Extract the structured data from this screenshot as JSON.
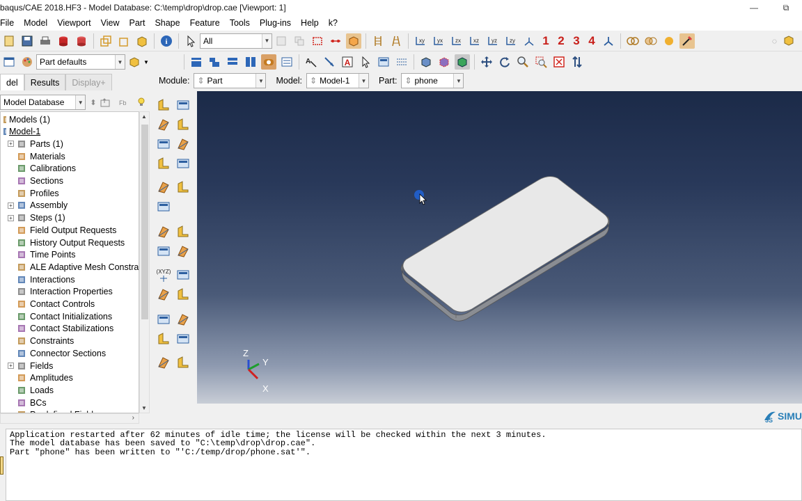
{
  "window": {
    "title": "baqus/CAE 2018.HF3 - Model Database: C:\\temp\\drop\\drop.cae [Viewport: 1]",
    "minimize": "—",
    "restore": "⧉"
  },
  "menu": [
    {
      "label": "File",
      "ul": "F"
    },
    {
      "label": "Model",
      "ul": "M"
    },
    {
      "label": "Viewport",
      "ul": "V"
    },
    {
      "label": "View",
      "ul": "V"
    },
    {
      "label": "Part",
      "ul": "P"
    },
    {
      "label": "Shape",
      "ul": "S"
    },
    {
      "label": "Feature",
      "ul": "F"
    },
    {
      "label": "Tools",
      "ul": "T"
    },
    {
      "label": "Plug-ins",
      "ul": "g"
    },
    {
      "label": "Help",
      "ul": "H"
    },
    {
      "label": "k?",
      "ul": ""
    }
  ],
  "toolbar": {
    "selection_filter": "All",
    "part_defaults": "Part defaults",
    "numbers": [
      "1",
      "2",
      "3",
      "4"
    ]
  },
  "context": {
    "module_label": "Module:",
    "module_value": "Part",
    "model_label": "Model:",
    "model_value": "Model-1",
    "part_label": "Part:",
    "part_value": "phone"
  },
  "tabs": {
    "model": "del",
    "results": "Results",
    "display": "Display+"
  },
  "tree_source": "Model Database",
  "tree": [
    {
      "label": "Models (1)",
      "depth": 0,
      "exp": false
    },
    {
      "label": "Model-1",
      "depth": 0,
      "exp": false,
      "underline": true
    },
    {
      "label": "Parts (1)",
      "depth": 1,
      "exp": true
    },
    {
      "label": "Materials",
      "depth": 1,
      "exp": false
    },
    {
      "label": "Calibrations",
      "depth": 1,
      "exp": false
    },
    {
      "label": "Sections",
      "depth": 1,
      "exp": false
    },
    {
      "label": "Profiles",
      "depth": 1,
      "exp": false
    },
    {
      "label": "Assembly",
      "depth": 1,
      "exp": true
    },
    {
      "label": "Steps (1)",
      "depth": 1,
      "exp": true
    },
    {
      "label": "Field Output Requests",
      "depth": 1,
      "exp": false
    },
    {
      "label": "History Output Requests",
      "depth": 1,
      "exp": false
    },
    {
      "label": "Time Points",
      "depth": 1,
      "exp": false
    },
    {
      "label": "ALE Adaptive Mesh Constraint",
      "depth": 1,
      "exp": false
    },
    {
      "label": "Interactions",
      "depth": 1,
      "exp": false
    },
    {
      "label": "Interaction Properties",
      "depth": 1,
      "exp": false
    },
    {
      "label": "Contact Controls",
      "depth": 1,
      "exp": false
    },
    {
      "label": "Contact Initializations",
      "depth": 1,
      "exp": false
    },
    {
      "label": "Contact Stabilizations",
      "depth": 1,
      "exp": false
    },
    {
      "label": "Constraints",
      "depth": 1,
      "exp": false
    },
    {
      "label": "Connector Sections",
      "depth": 1,
      "exp": false
    },
    {
      "label": "Fields",
      "depth": 1,
      "exp": true
    },
    {
      "label": "Amplitudes",
      "depth": 1,
      "exp": false
    },
    {
      "label": "Loads",
      "depth": 1,
      "exp": false
    },
    {
      "label": "BCs",
      "depth": 1,
      "exp": false
    },
    {
      "label": "Predefined Fields",
      "depth": 1,
      "exp": false
    }
  ],
  "triad": {
    "z": "Z",
    "y": "Y",
    "x": "X"
  },
  "toolbox_label": "(XYZ)",
  "brand": "SIMU",
  "messages": [
    "Application restarted after 62 minutes of idle time; the license will be checked within the next 3 minutes.",
    "The model database has been saved to \"C:\\temp\\drop\\drop.cae\".",
    "Part \"phone\" has been written to \"'C:/temp/drop/phone.sat'\"."
  ],
  "colors": {
    "accent_red": "#c8201b",
    "accent_blue": "#2a7fb8",
    "viewport_top": "#1b2a48",
    "viewport_bottom": "#c8cdd6"
  }
}
